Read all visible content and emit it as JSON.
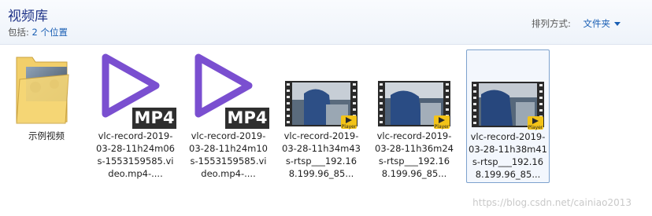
{
  "library": {
    "title": "视频库",
    "includes_label": "包括:",
    "locations_link": "2 个位置"
  },
  "sort": {
    "label": "排列方式:",
    "value": "文件夹"
  },
  "items": [
    {
      "label": "示例视频",
      "kind": "folder"
    },
    {
      "label": "vlc-record-2019-03-28-11h24m06s-1553159585.video.mp4-....",
      "kind": "mp4",
      "badge": "MP4"
    },
    {
      "label": "vlc-record-2019-03-28-11h24m10s-1553159585.video.mp4-....",
      "kind": "mp4",
      "badge": "MP4"
    },
    {
      "label": "vlc-record-2019-03-28-11h34m43s-rtsp___192.168.199.96_85...",
      "kind": "video",
      "badge": "Player"
    },
    {
      "label": "vlc-record-2019-03-28-11h36m24s-rtsp___192.168.199.96_85...",
      "kind": "video",
      "badge": "Player"
    },
    {
      "label": "vlc-record-2019-03-28-11h38m41s-rtsp___192.168.199.96_85...",
      "kind": "video",
      "badge": "Player",
      "selected": true
    }
  ],
  "watermark": "https://blog.csdn.net/cainiao2013",
  "colors": {
    "title": "#1e3287",
    "link": "#1a5fb4",
    "play_purple": "#7a4fd0",
    "badge_dark": "#2f2f2f",
    "player_yellow": "#f3c318",
    "selection_border": "#7da2ce"
  }
}
